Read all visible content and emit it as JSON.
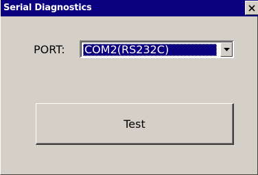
{
  "window": {
    "title": "Serial Diagnostics",
    "close_glyph": "×"
  },
  "port": {
    "label": "PORT:",
    "selected": "COM2(RS232C)"
  },
  "actions": {
    "test_label": "Test"
  },
  "colors": {
    "titlebar": "#0a0080",
    "window_bg": "#d4d0c8",
    "selection": "#0a0080"
  }
}
